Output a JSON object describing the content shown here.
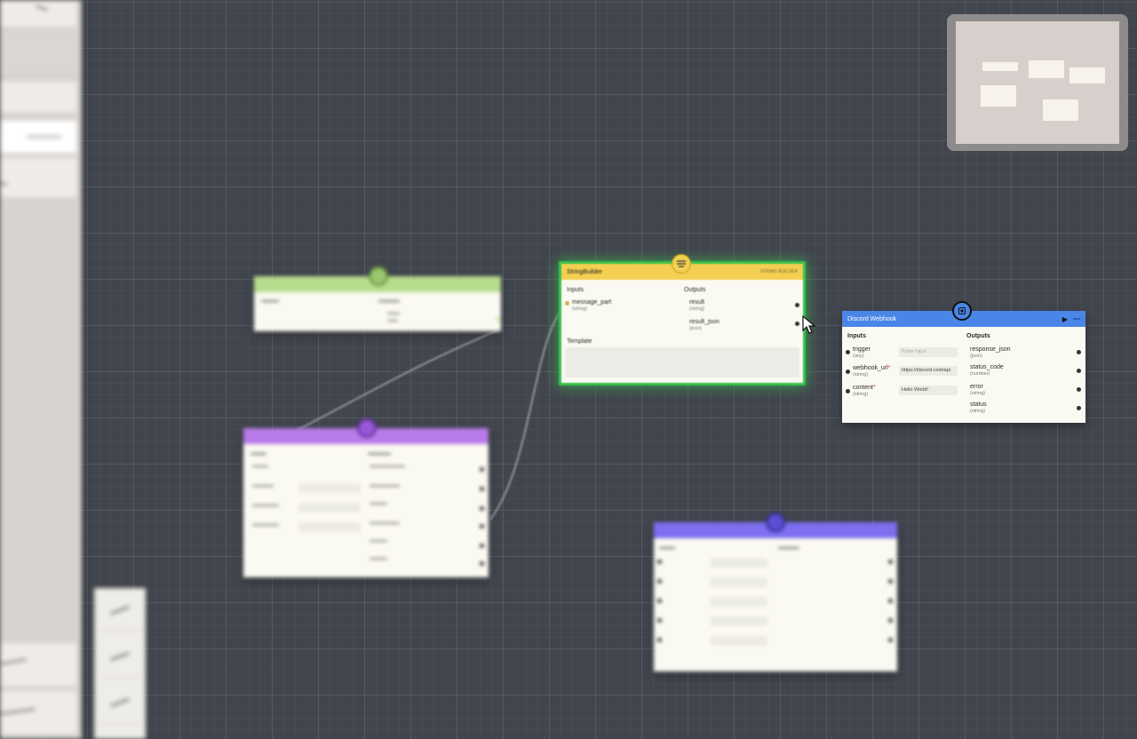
{
  "canvas": {
    "background": "#41454d"
  },
  "nodes": {
    "string_builder": {
      "title": "StringBuilder",
      "subtitle": "STRING BUILDER",
      "color": "#f3cf52",
      "inputs_label": "Inputs",
      "outputs_label": "Outputs",
      "template_label": "Template",
      "input_name": "message_part",
      "input_type": "(string)",
      "outputs": [
        {
          "name": "result",
          "type": "(string)"
        },
        {
          "name": "result_json",
          "type": "(json)"
        }
      ]
    },
    "discord_webhook": {
      "title": "Discord Webhook",
      "color": "#4a86e8",
      "run_label": "▶",
      "inputs_label": "Inputs",
      "outputs_label": "Outputs",
      "inputs": [
        {
          "name": "trigger",
          "type": "(any)",
          "value": "Pulse Input",
          "placeholder": true
        },
        {
          "name": "webhook_url",
          "required": "*",
          "type": "(string)",
          "value": "https://discord.com/api"
        },
        {
          "name": "content",
          "required": "*",
          "type": "(string)",
          "value": "Hello World!"
        }
      ],
      "outputs": [
        {
          "name": "response_json",
          "type": "(json)"
        },
        {
          "name": "status_code",
          "type": "(number)"
        },
        {
          "name": "error",
          "type": "(string)"
        },
        {
          "name": "status",
          "type": "(string)"
        }
      ]
    }
  },
  "minimap": {
    "background": "#d6cfcb"
  },
  "colors": {
    "green_node": "#b8dc8e",
    "purple_node": "#b97bea",
    "violet_node": "#7d6ff0",
    "selection_glow": "#36c24c"
  }
}
